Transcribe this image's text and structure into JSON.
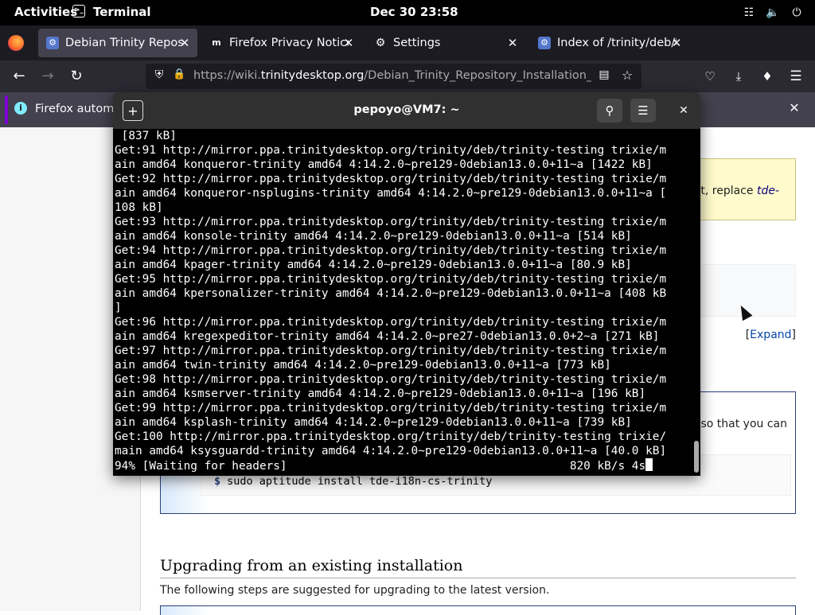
{
  "topbar": {
    "activities": "Activities",
    "app_name": "Terminal",
    "clock": "Dec 30  23:58"
  },
  "tabs": [
    {
      "label": "Debian Trinity Reposito",
      "active": true
    },
    {
      "label": "Firefox Privacy Notice -",
      "active": false
    },
    {
      "label": "Settings",
      "active": false
    },
    {
      "label": "Index of /trinity/deb/tri",
      "active": false
    }
  ],
  "urlbar": {
    "url_host_prefix": "https://wiki.",
    "url_host": "trinitydesktop.org",
    "url_path": "/Debian_Trinity_Repository_Installation_Ins"
  },
  "notification": {
    "text": "Firefox automa"
  },
  "page": {
    "box1_text_plain": "t, replace ",
    "box1_text_em": "tde-",
    "expand_label": "Expand",
    "box3_text": "so that you can",
    "command": "sudo aptitude install tde-i18n-cs-trinity",
    "prompt": "$",
    "heading": "Upgrading from an existing installation",
    "paragraph": "The following steps are suggested for upgrading to the latest version."
  },
  "terminal": {
    "title": "pepoyo@VM7: ~",
    "lines": [
      " [837 kB]",
      "Get:91 http://mirror.ppa.trinitydesktop.org/trinity/deb/trinity-testing trixie/m",
      "ain amd64 konqueror-trinity amd64 4:14.2.0~pre129-0debian13.0.0+11~a [1422 kB]",
      "Get:92 http://mirror.ppa.trinitydesktop.org/trinity/deb/trinity-testing trixie/m",
      "ain amd64 konqueror-nsplugins-trinity amd64 4:14.2.0~pre129-0debian13.0.0+11~a [",
      "108 kB]",
      "Get:93 http://mirror.ppa.trinitydesktop.org/trinity/deb/trinity-testing trixie/m",
      "ain amd64 konsole-trinity amd64 4:14.2.0~pre129-0debian13.0.0+11~a [514 kB]",
      "Get:94 http://mirror.ppa.trinitydesktop.org/trinity/deb/trinity-testing trixie/m",
      "ain amd64 kpager-trinity amd64 4:14.2.0~pre129-0debian13.0.0+11~a [80.9 kB]",
      "Get:95 http://mirror.ppa.trinitydesktop.org/trinity/deb/trinity-testing trixie/m",
      "ain amd64 kpersonalizer-trinity amd64 4:14.2.0~pre129-0debian13.0.0+11~a [408 kB",
      "]",
      "Get:96 http://mirror.ppa.trinitydesktop.org/trinity/deb/trinity-testing trixie/m",
      "ain amd64 kregexpeditor-trinity amd64 4:14.2.0~pre27-0debian13.0.0+2~a [271 kB]",
      "Get:97 http://mirror.ppa.trinitydesktop.org/trinity/deb/trinity-testing trixie/m",
      "ain amd64 twin-trinity amd64 4:14.2.0~pre129-0debian13.0.0+11~a [773 kB]",
      "Get:98 http://mirror.ppa.trinitydesktop.org/trinity/deb/trinity-testing trixie/m",
      "ain amd64 ksmserver-trinity amd64 4:14.2.0~pre129-0debian13.0.0+11~a [196 kB]",
      "Get:99 http://mirror.ppa.trinitydesktop.org/trinity/deb/trinity-testing trixie/m",
      "ain amd64 ksplash-trinity amd64 4:14.2.0~pre129-0debian13.0.0+11~a [739 kB]",
      "Get:100 http://mirror.ppa.trinitydesktop.org/trinity/deb/trinity-testing trixie/",
      "main amd64 ksysguardd-trinity amd64 4:14.2.0~pre129-0debian13.0.0+11~a [40.0 kB]"
    ],
    "status_line": "94% [Waiting for headers]                                         820 kB/s 4s"
  }
}
